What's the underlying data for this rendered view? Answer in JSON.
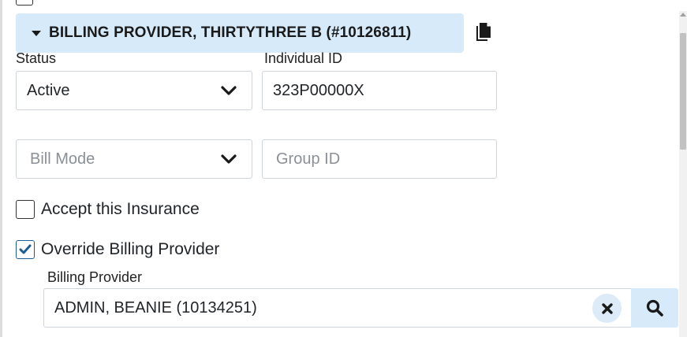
{
  "header": {
    "title": "BILLING PROVIDER, THIRTYTHREE B (#10126811)",
    "copy_icon": "copy-icon",
    "collapse_icon": "caret-down-icon"
  },
  "status": {
    "label": "Status",
    "value": "Active"
  },
  "individual_id": {
    "label": "Individual ID",
    "value": "323P00000X"
  },
  "bill_mode": {
    "placeholder": "Bill Mode"
  },
  "group_id": {
    "placeholder": "Group ID"
  },
  "accept_insurance": {
    "label": "Accept this Insurance",
    "checked": false
  },
  "override_billing": {
    "label": "Override Billing Provider",
    "checked": true
  },
  "billing_provider": {
    "label": "Billing Provider",
    "value": "ADMIN, BEANIE (10134251)",
    "clear_icon": "close-icon",
    "search_icon": "search-icon"
  },
  "colors": {
    "header_bg": "#d6eafa",
    "field_border": "#ced4da",
    "text": "#212529",
    "placeholder": "#8a9096"
  }
}
